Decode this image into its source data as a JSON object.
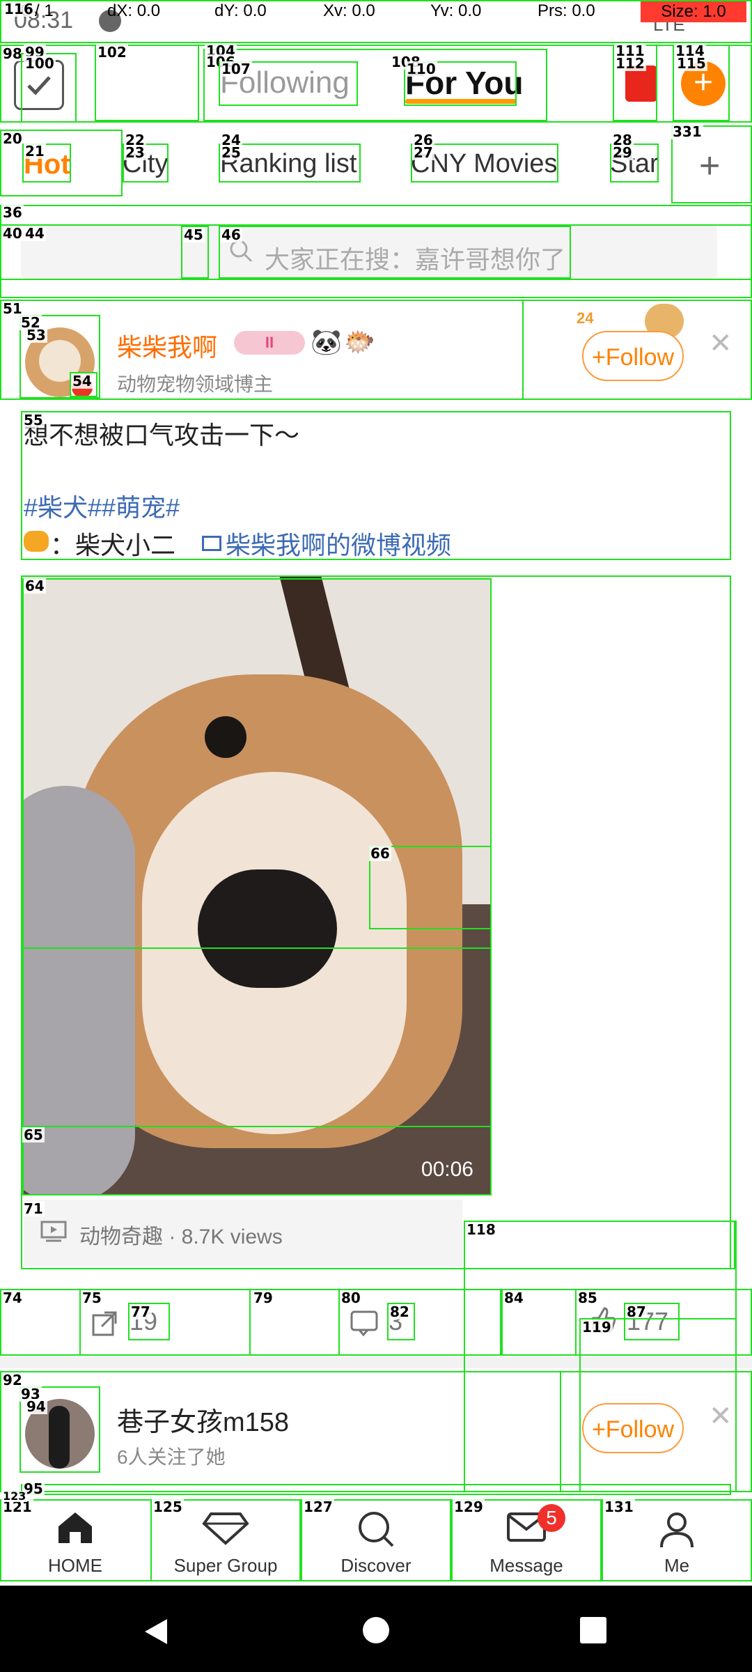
{
  "status": {
    "time": "08:31",
    "pointer": "0 / 1",
    "dx": "dX: 0.0",
    "dy": "dY: 0.0",
    "xv": "Xv: 0.0",
    "yv": "Yv: 0.0",
    "prs": "Prs: 0.0",
    "size": "Size: 1.0",
    "network": "LTE"
  },
  "header": {
    "tab_following": "Following",
    "tab_for_you": "For You"
  },
  "categories": [
    "Hot",
    "City",
    "Ranking list",
    "CNY Movies",
    "Star"
  ],
  "search": {
    "placeholder": "大家正在搜：嘉许哥想你了"
  },
  "post1": {
    "username": "柴柴我啊",
    "badge_level": "II",
    "subtitle": "动物宠物领域博主",
    "follow": "Follow",
    "text_line1": "想不想被口气攻击一下～",
    "hashtags": "#柴犬##萌宠#",
    "credit_prefix": "：柴犬小二",
    "credit_link": "柴柴我啊的微博视频",
    "duration": "00:06",
    "meta": "动物奇趣 · 8.7K views",
    "reposts": "19",
    "comments": "3",
    "likes": "177"
  },
  "post2": {
    "username": "巷子女孩m158",
    "subtitle": "6人关注了她",
    "follow": "Follow"
  },
  "nav": {
    "home": "HOME",
    "super_group": "Super Group",
    "discover": "Discover",
    "message": "Message",
    "message_badge": "5",
    "me": "Me"
  },
  "overlay_numbers": {
    "n116": "116",
    "n98": "98",
    "n99": "99",
    "n100": "100",
    "n102": "102",
    "n104": "104",
    "n106": "106",
    "n107": "107",
    "n108": "108",
    "n110": "110",
    "n111": "111",
    "n112": "112",
    "n114": "114",
    "n115": "115",
    "n20": "20",
    "n21": "21",
    "n22": "22",
    "n23": "23",
    "n24": "24",
    "n25": "25",
    "n26": "26",
    "n27": "27",
    "n28": "28",
    "n29": "29",
    "n331": "331",
    "n36": "36",
    "n40": "40",
    "n44": "44",
    "n45": "45",
    "n46": "46",
    "n51": "51",
    "n52": "52",
    "n53": "53",
    "n54": "54",
    "n55": "55",
    "n64": "64",
    "n66": "66",
    "n65": "65",
    "n71": "71",
    "n118": "118",
    "n74": "74",
    "n75": "75",
    "n77": "77",
    "n79": "79",
    "n80": "80",
    "n82": "82",
    "n84": "84",
    "n85": "85",
    "n87": "87",
    "n119": "119",
    "n92": "92",
    "n93": "93",
    "n94": "94",
    "n95": "95",
    "n121": "121",
    "n123": "123",
    "n125": "125",
    "n127": "127",
    "n129": "129",
    "n131": "131"
  },
  "colors": {
    "accent": "#ff8200",
    "link": "#3d6bb3",
    "overlay_green": "#20e020",
    "badge_red": "#f0302b"
  }
}
